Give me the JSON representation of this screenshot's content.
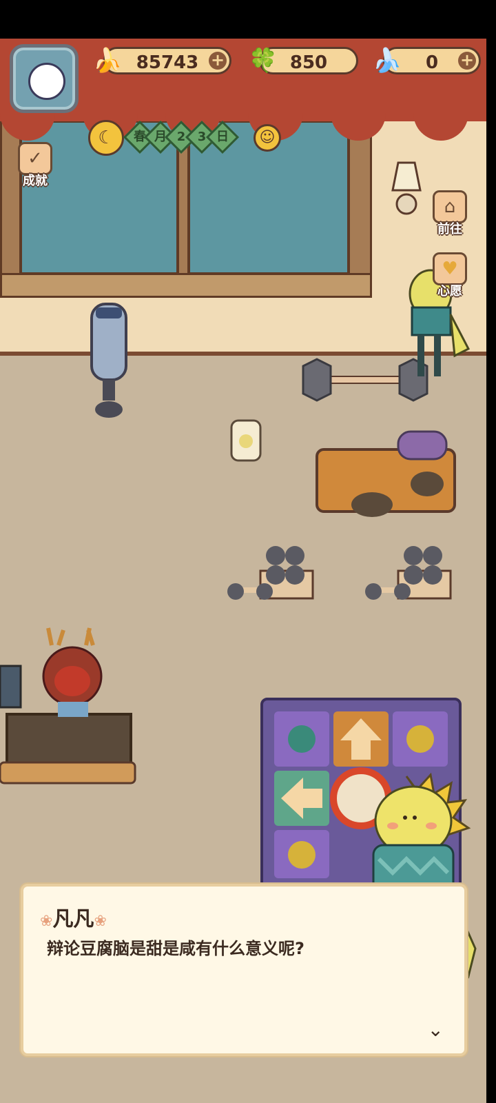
{
  "currencies": [
    {
      "icon": "banana-icon",
      "glyph": "🍌",
      "value": "85743",
      "has_plus": true
    },
    {
      "icon": "clover-icon",
      "glyph": "🍀",
      "value": "850",
      "has_plus": false
    },
    {
      "icon": "blue-banana-icon",
      "glyph": "🍌",
      "value": "0",
      "has_plus": true
    }
  ],
  "date": {
    "season": "春",
    "month_label": "月",
    "day_digits": [
      "2",
      "3"
    ],
    "day_label": "日"
  },
  "side_buttons": {
    "achievements": "成就",
    "go": "前往",
    "wish": "心愿"
  },
  "dialog": {
    "speaker": "凡凡",
    "text": "辩论豆腐脑是甜是咸有什么意义呢?"
  },
  "colors": {
    "curtain": "#b44733",
    "wall": "#f1dcb7",
    "floor": "#c7b69d",
    "dialog_bg": "#fff8e6"
  }
}
